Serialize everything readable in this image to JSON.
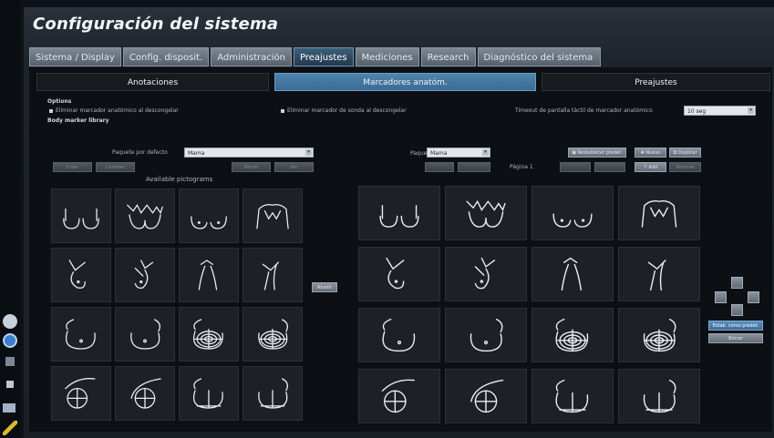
{
  "window": {
    "title": "Configuración del sistema"
  },
  "tabs": [
    "Sistema / Display",
    "Config. disposit.",
    "Administración",
    "Preajustes",
    "Mediciones",
    "Research",
    "Diagnóstico del sistema"
  ],
  "active_tab": "Preajustes",
  "subtabs": [
    "Anotaciones",
    "Marcadores anatóm.",
    "Preajustes"
  ],
  "active_subtab": "Marcadores anatóm.",
  "options": {
    "header": "Options",
    "opt1": "Eliminar marcador anatómico al descongelar",
    "opt2": "Eliminar marcador de sonda al descongelar",
    "timeout_label": "Timeout de pantalla táctil de marcador anatómico",
    "timeout_value": "10 seg"
  },
  "library": {
    "header": "Body marker library",
    "paquete_defecto_label": "Paquete por defecto",
    "paquete_defecto_value": "Mama",
    "available_label": "Available pictograms",
    "add_button": "Añadir",
    "left_buttons": [
      "Crear",
      "Cambiar",
      "Borrar",
      "Ver"
    ]
  },
  "right_panel": {
    "paquete_label": "Paquete",
    "paquete_value": "Mama",
    "pagina_label": "Página 1",
    "buttons": {
      "restablecer": "Restablecer predet.",
      "nuevo": "Nuevo",
      "duplicar": "Duplicar",
      "add": "Add",
      "remove": "Remove"
    },
    "side_buttons": {
      "set_default": "Estab. como predet.",
      "delete": "Borrar"
    }
  },
  "left_icons": [
    "settings-icon",
    "help-icon",
    "printer-icon",
    "volume-icon",
    "image-icon",
    "pen-icon"
  ]
}
